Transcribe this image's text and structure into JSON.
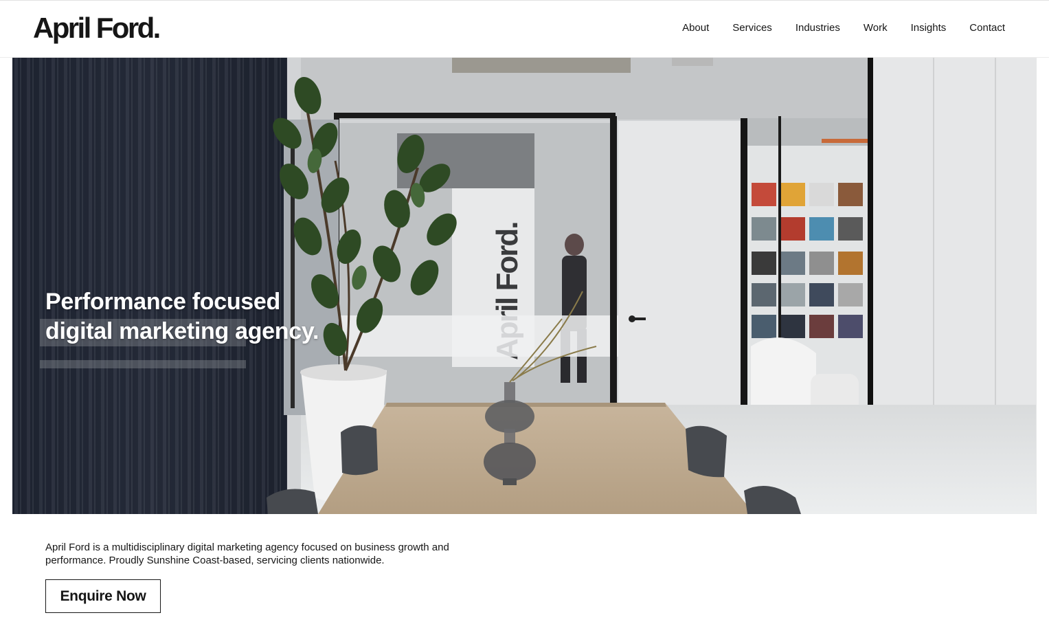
{
  "brand": {
    "logo_text": "April Ford."
  },
  "nav": {
    "items": [
      {
        "label": "About"
      },
      {
        "label": "Services"
      },
      {
        "label": "Industries"
      },
      {
        "label": "Work"
      },
      {
        "label": "Insights"
      },
      {
        "label": "Contact"
      }
    ]
  },
  "hero": {
    "heading_line1": "Performance focused",
    "heading_line2": "digital marketing agency.",
    "image_description_signage": "April Ford."
  },
  "intro": {
    "text": "April Ford is a multidisciplinary digital marketing agency focused on business growth and performance. Proudly Sunshine Coast-based, servicing clients nationwide.",
    "cta_label": "Enquire Now"
  },
  "colors": {
    "text": "#161616",
    "background": "#ffffff",
    "hero_text": "#ffffff"
  }
}
